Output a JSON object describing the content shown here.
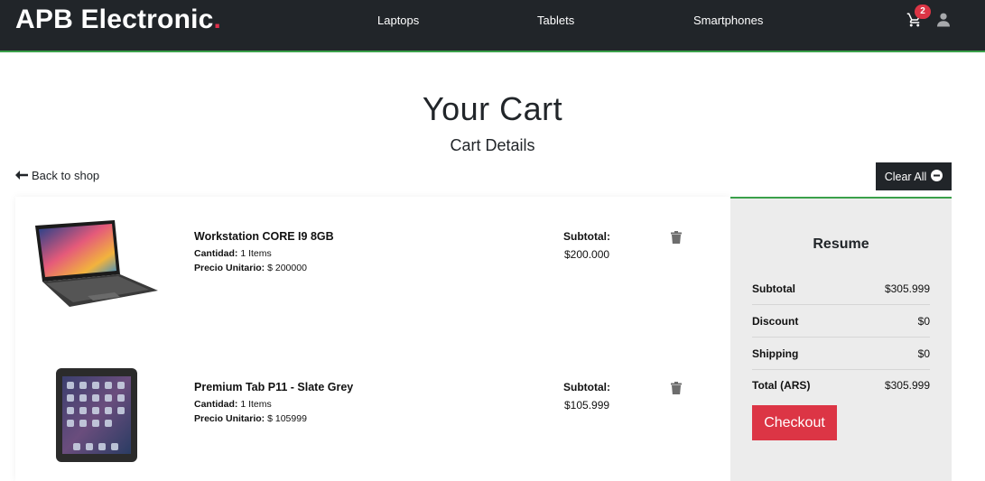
{
  "navbar": {
    "brand": "APB Electronic",
    "brand_dot": ".",
    "links": [
      "Laptops",
      "Tablets",
      "Smartphones"
    ],
    "cart_count": "2"
  },
  "page": {
    "title": "Your Cart",
    "subtitle": "Cart Details",
    "back_label": "Back to shop",
    "clear_label": "Clear All"
  },
  "products": [
    {
      "name": "Workstation CORE I9 8GB",
      "qty_label": "Cantidad:",
      "qty_value": "1 Items",
      "price_label": "Precio Unitario:",
      "price_value": "$ 200000",
      "subtotal_label": "Subtotal:",
      "subtotal_value": "$200.000",
      "icon": "laptop-image"
    },
    {
      "name": "Premium Tab P11 - Slate Grey",
      "qty_label": "Cantidad:",
      "qty_value": "1 Items",
      "price_label": "Precio Unitario:",
      "price_value": "$ 105999",
      "subtotal_label": "Subtotal:",
      "subtotal_value": "$105.999",
      "icon": "tablet-image"
    }
  ],
  "resume": {
    "title": "Resume",
    "rows": [
      {
        "label": "Subtotal",
        "value": "$305.999"
      },
      {
        "label": "Discount",
        "value": "$0"
      },
      {
        "label": "Shipping",
        "value": "$0"
      },
      {
        "label": "Total (ARS)",
        "value": "$305.999"
      }
    ],
    "checkout_label": "Checkout"
  },
  "colors": {
    "navbar": "#212529",
    "accent_green": "#3aa04a",
    "accent_red": "#dc3545",
    "resume_bg": "#ececec"
  }
}
